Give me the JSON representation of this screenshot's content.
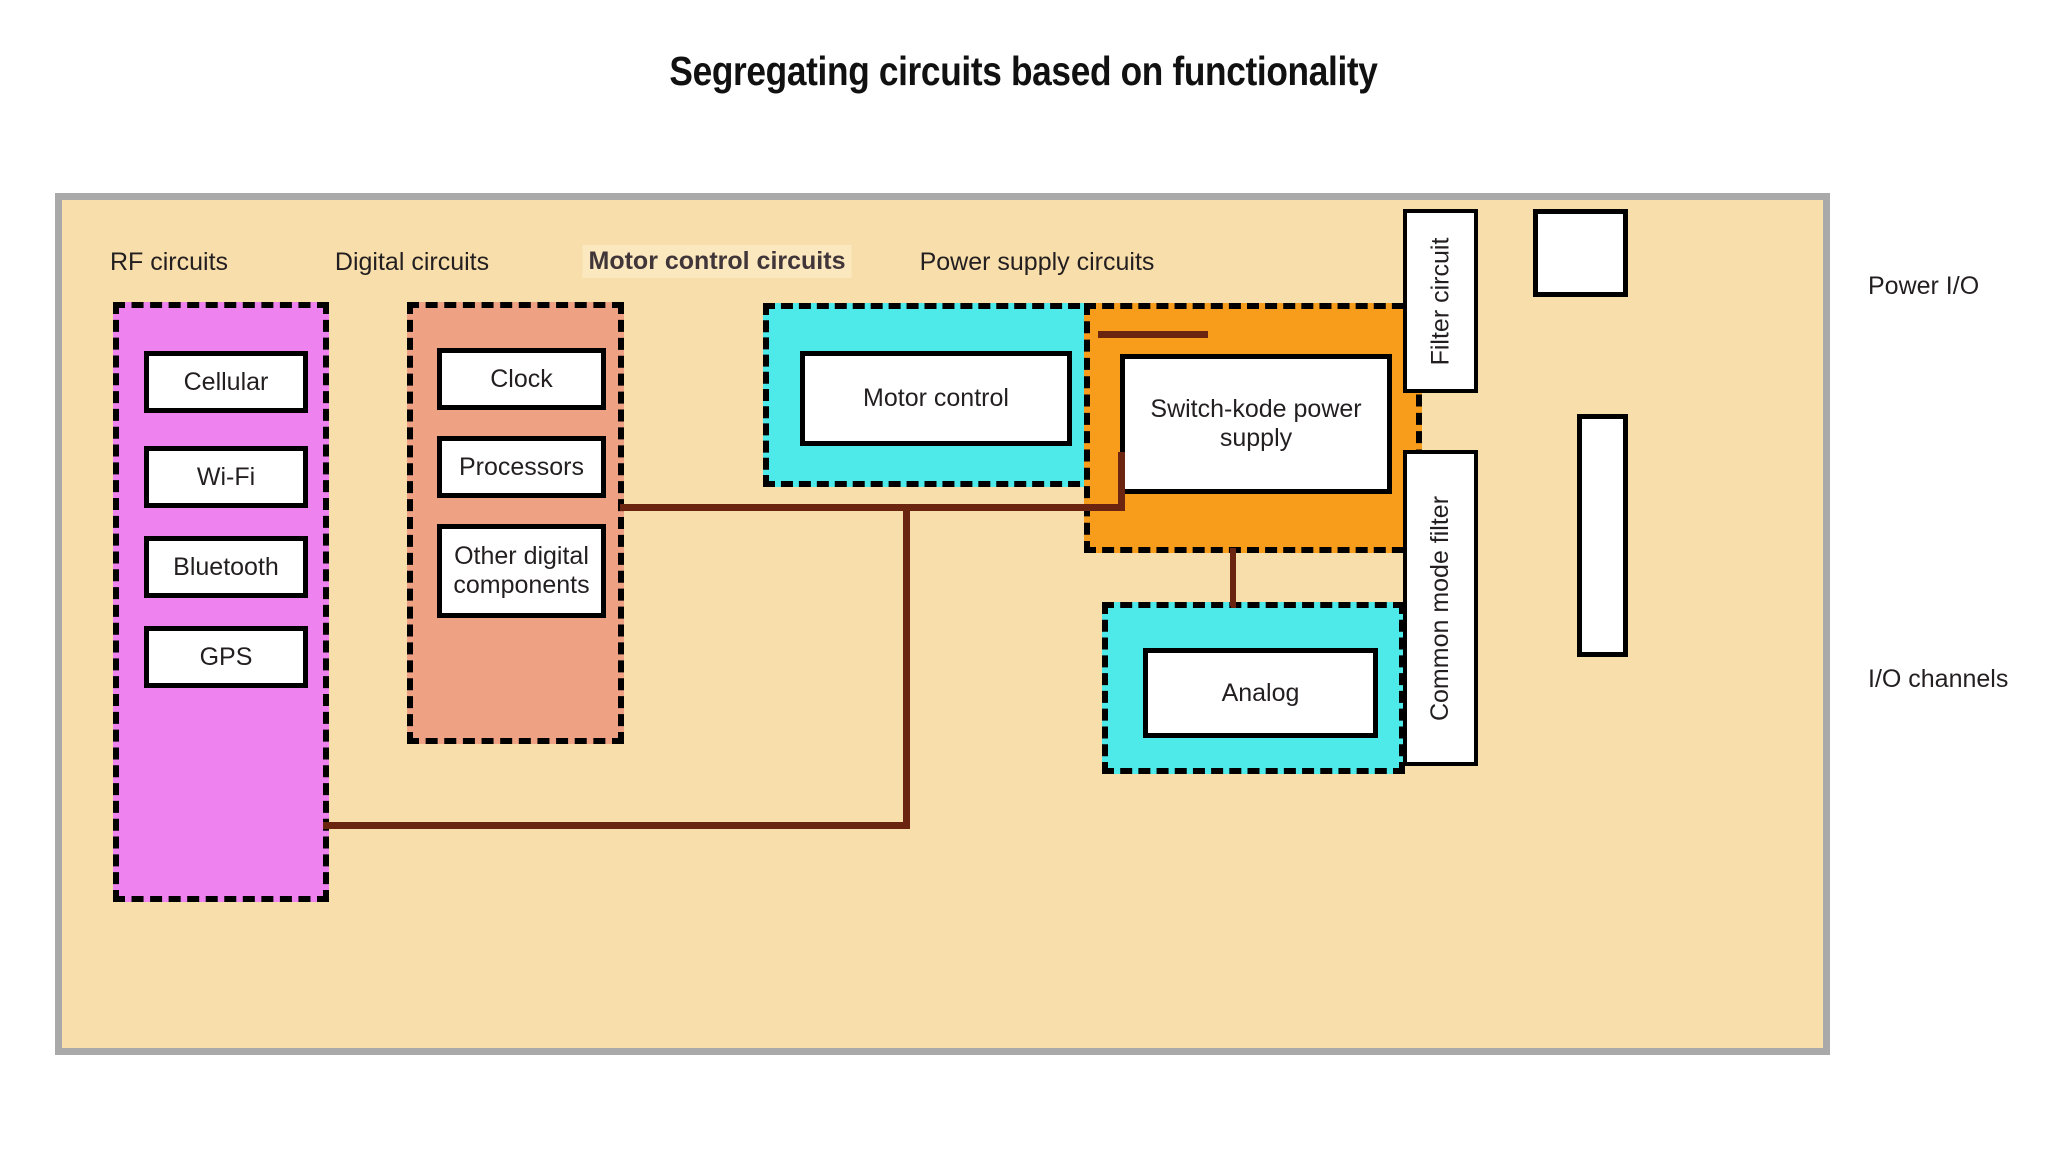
{
  "title": "Segregating circuits based on functionality",
  "board": {
    "name": "pcb-board",
    "fill_color": "#f8deab",
    "border_color": "#a9a9a9"
  },
  "groups": [
    {
      "id": "rf",
      "label": "RF circuits",
      "fill_color": "#ee82ee",
      "emphasis": false,
      "blocks": [
        {
          "label": "Cellular"
        },
        {
          "label": "Wi-Fi"
        },
        {
          "label": "Bluetooth"
        },
        {
          "label": "GPS"
        }
      ]
    },
    {
      "id": "digital",
      "label": "Digital circuits",
      "fill_color": "#eea183",
      "emphasis": false,
      "blocks": [
        {
          "label": "Clock"
        },
        {
          "label": "Processors"
        },
        {
          "label": "Other digital components"
        }
      ]
    },
    {
      "id": "motor",
      "label": "Motor control circuits",
      "fill_color": "#4ee9e9",
      "emphasis": true,
      "blocks": [
        {
          "label": "Motor control"
        }
      ]
    },
    {
      "id": "power",
      "label": "Power supply circuits",
      "fill_color": "#f89c1c",
      "emphasis": false,
      "blocks": [
        {
          "label": "Switch-kode power supply"
        }
      ]
    },
    {
      "id": "analog",
      "label": "",
      "fill_color": "#4ee9e9",
      "emphasis": false,
      "blocks": [
        {
          "label": "Analog"
        }
      ]
    }
  ],
  "side_components": [
    {
      "id": "filter-circuit",
      "label": "Filter circuit"
    },
    {
      "id": "common-mode-filter",
      "label": "Common mode filter"
    }
  ],
  "edge_connectors": [
    {
      "id": "power-io",
      "label": "Power I/O"
    },
    {
      "id": "io-channels",
      "label": "I/O channels"
    }
  ],
  "wire_color": "#6b2410"
}
